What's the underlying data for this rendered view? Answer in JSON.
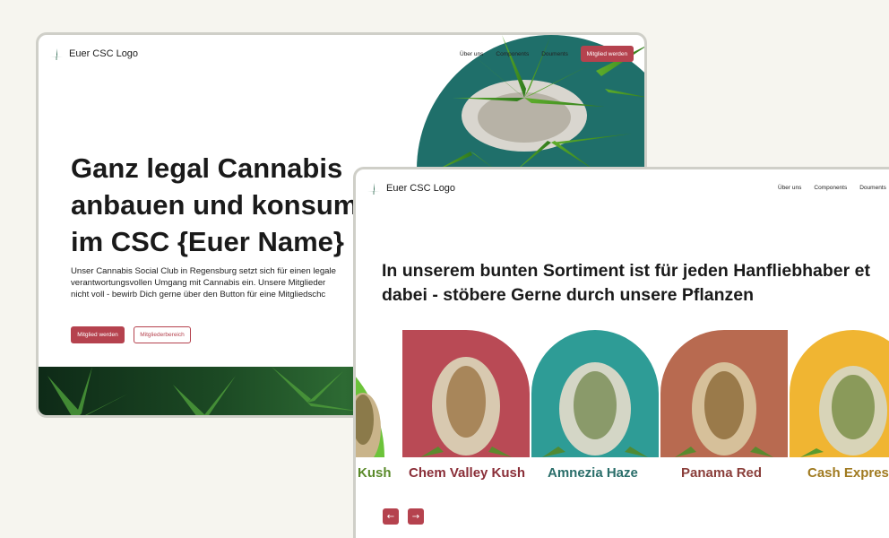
{
  "brand": {
    "logo_text": "Euer CSC Logo",
    "accent": "#b5424e"
  },
  "window1": {
    "nav": {
      "about": "Über uns",
      "components": "Components",
      "docs": "Douments",
      "cta": "Mitglied werden"
    },
    "hero": {
      "title": "Ganz legal Cannabis\nanbauen und konsumi\nim CSC {Euer Name}",
      "description": "Unser Cannabis Social Club in Regensburg setzt sich für einen legale\nverantwortungsvollen Umgang mit Cannabis ein. Unsere Mitglieder\nnicht voll - bewirb Dich gerne über den Button für eine Mitgliedschc",
      "primary_button": "Mitglied werden",
      "secondary_button": "Mitgliederbereich"
    }
  },
  "window2": {
    "nav": {
      "about": "Über uns",
      "components": "Components",
      "docs": "Douments"
    },
    "section_title": "In unserem bunten Sortiment ist für jeden Hanfliebhaber et\ndabei - stöbere Gerne durch unsere Pflanzen",
    "strains": [
      {
        "name": "Kush",
        "bg": "#6cc33a",
        "label_color": "#5a8a2a"
      },
      {
        "name": "Chem Valley Kush",
        "bg": "#b94a55",
        "label_color": "#8a2e38"
      },
      {
        "name": "Amnezia Haze",
        "bg": "#2e9c96",
        "label_color": "#2a6e6a"
      },
      {
        "name": "Panama Red",
        "bg": "#b86a50",
        "label_color": "#8a3e3a"
      },
      {
        "name": "Cash Express",
        "bg": "#f0b532",
        "label_color": "#a07a20"
      }
    ],
    "carousel": {
      "prev_icon": "arrow-left-icon",
      "next_icon": "arrow-right-icon"
    }
  }
}
